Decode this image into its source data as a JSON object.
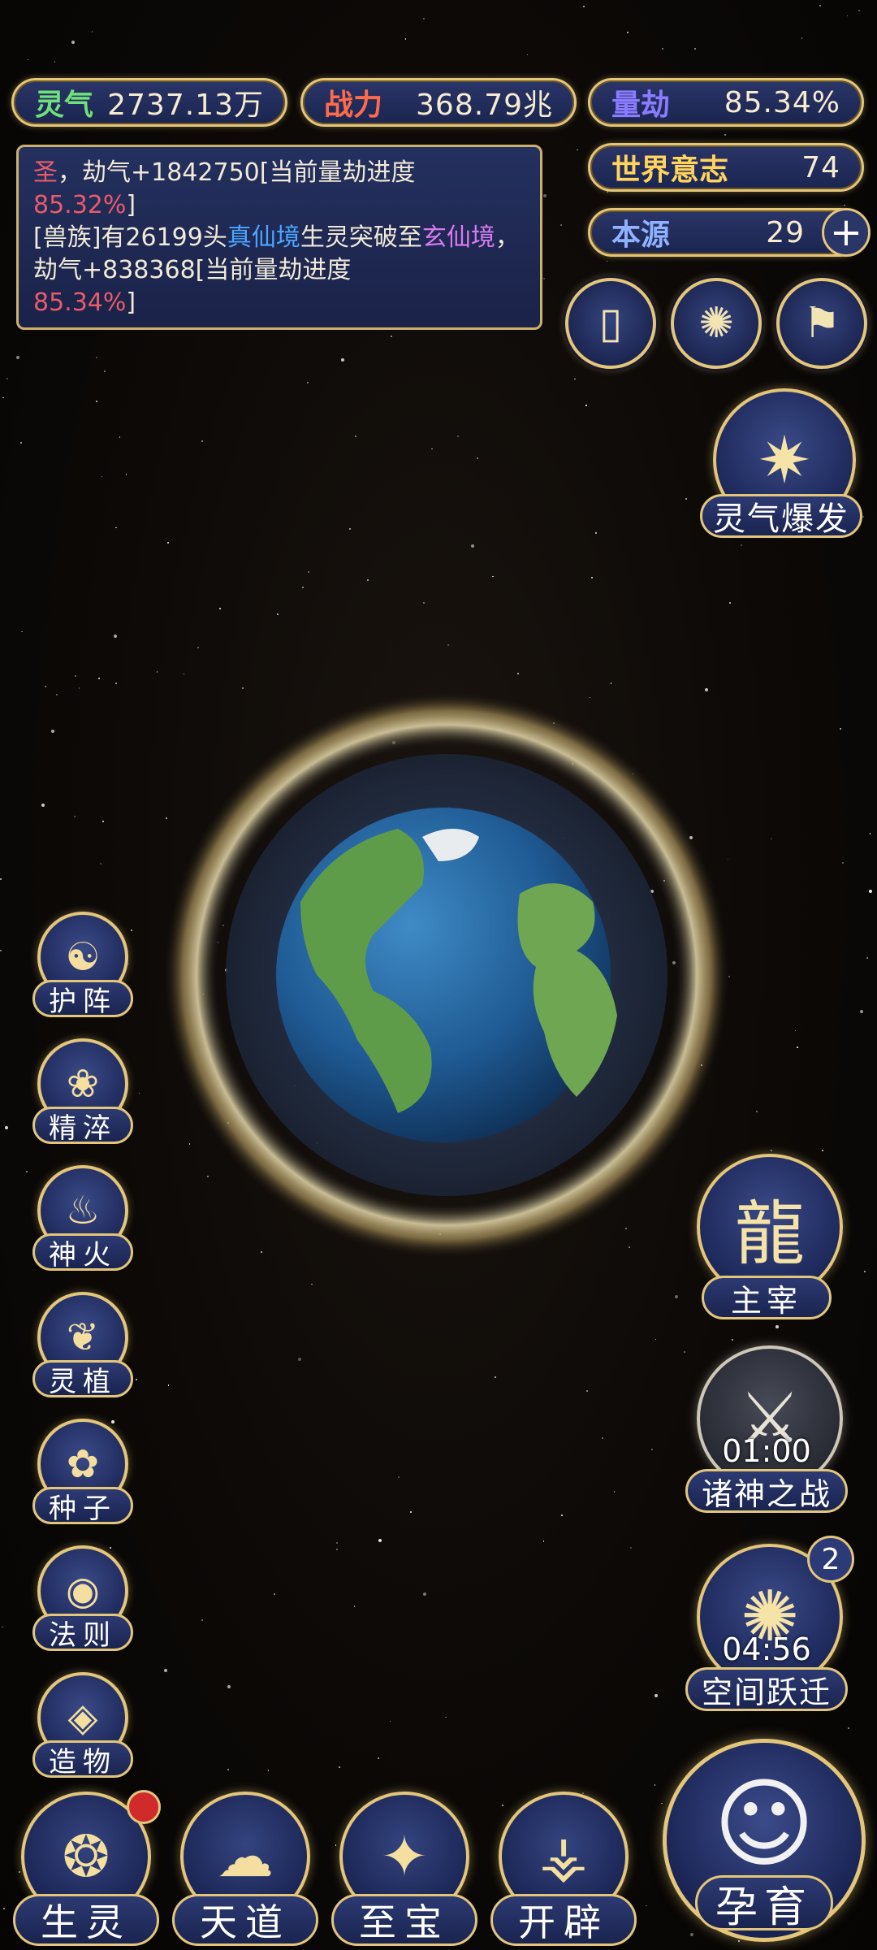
{
  "stats": {
    "lingqi": {
      "label": "灵气",
      "value": "2737.13万",
      "color": "#6fe07a"
    },
    "zhanli": {
      "label": "战力",
      "value": "368.79兆",
      "color": "#ff6b4a"
    },
    "liangjie": {
      "label": "量劫",
      "value": "85.34%",
      "color": "#8a7cff"
    },
    "shijie": {
      "label": "世界意志",
      "value": "74",
      "color": "#ffd35c"
    },
    "benyuan": {
      "label": "本源",
      "value": "29",
      "color": "#8fb2ff"
    }
  },
  "log": {
    "line1_a": "圣",
    "line1_b": "，劫气+1842750[当前量劫进度",
    "line1_c": "85.32%",
    "line1_d": "]",
    "line2_a": "[兽族]有26199头",
    "line2_b": "真仙境",
    "line2_c": "生灵突破至",
    "line2_d": "玄仙境",
    "line2_e": "，劫气+838368[当前量劫进度",
    "line2_f": "85.34%",
    "line2_g": "]"
  },
  "icons": {
    "plus": "+",
    "card": "▯",
    "swirl": "✺",
    "flag": "⚑"
  },
  "burst": {
    "label": "灵气爆发"
  },
  "right": {
    "zhuzai": {
      "label": "主宰"
    },
    "zhushen": {
      "label": "诸神之战",
      "timer": "01:00"
    },
    "kongjian": {
      "label": "空间跃迁",
      "timer": "04:56",
      "badge": "2"
    }
  },
  "left": [
    {
      "label": "护阵",
      "glyph": "☯"
    },
    {
      "label": "精淬",
      "glyph": "❀"
    },
    {
      "label": "神火",
      "glyph": "♨"
    },
    {
      "label": "灵植",
      "glyph": "❦"
    },
    {
      "label": "种子",
      "glyph": "✿"
    },
    {
      "label": "法则",
      "glyph": "◉"
    },
    {
      "label": "造物",
      "glyph": "◈"
    }
  ],
  "bottom": [
    {
      "label": "生灵",
      "glyph": "❂"
    },
    {
      "label": "天道",
      "glyph": "☁"
    },
    {
      "label": "至宝",
      "glyph": "✦"
    },
    {
      "label": "开辟",
      "glyph": "⚶"
    }
  ],
  "yunyu": {
    "label": "孕育",
    "glyph": "☺"
  }
}
